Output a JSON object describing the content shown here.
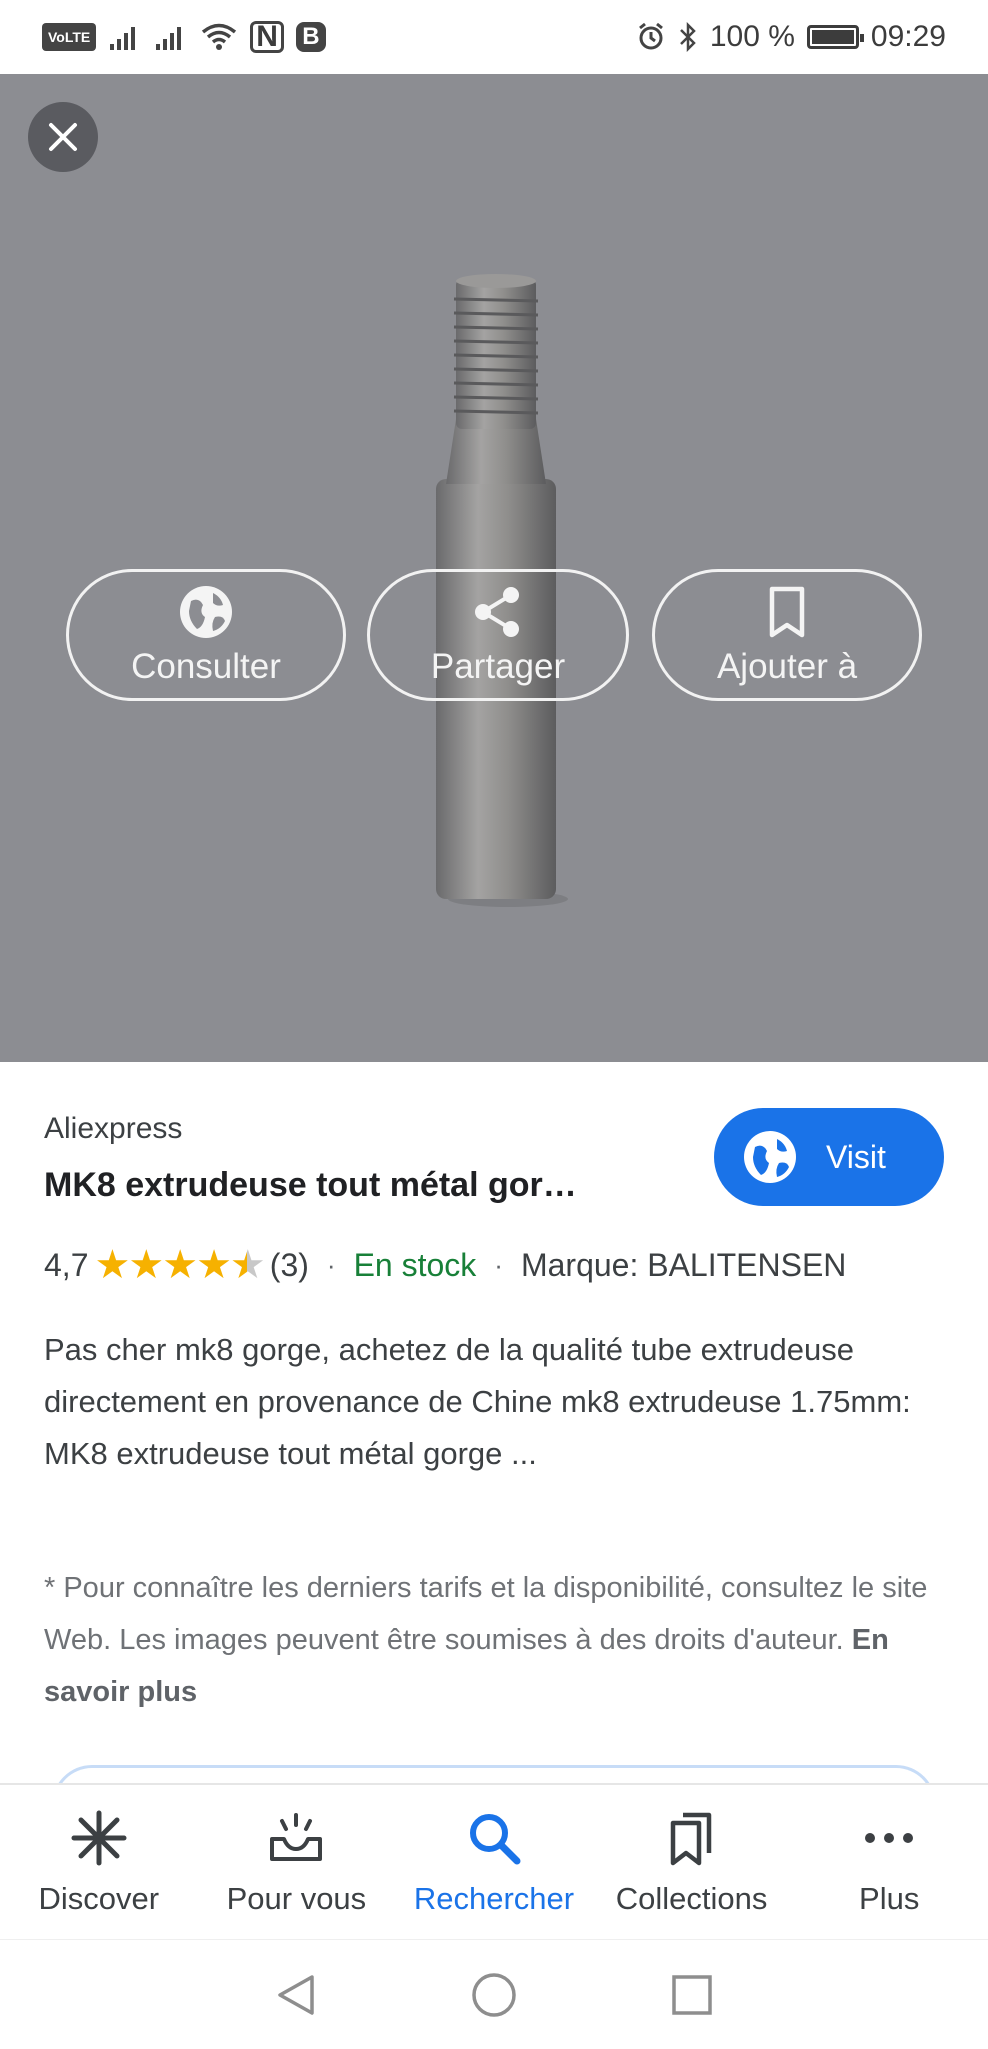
{
  "status_bar": {
    "volte": "VoLTE",
    "bluetooth_badge": "B",
    "battery": "100 %",
    "time": "09:29"
  },
  "viewer": {
    "background": "#8c8d92",
    "actions": [
      {
        "label": "Consulter",
        "icon": "globe-icon"
      },
      {
        "label": "Partager",
        "icon": "share-icon"
      },
      {
        "label": "Ajouter à",
        "icon": "bookmark-icon"
      }
    ]
  },
  "result": {
    "source": "Aliexpress",
    "title": "MK8 extrudeuse tout métal gor…",
    "visit_label": "Visit",
    "rating_value": "4,7",
    "rating_stars": 4.7,
    "review_count": "(3)",
    "separator": "·",
    "stock": "En stock",
    "brand": "Marque: BALITENSEN",
    "description": "Pas cher mk8 gorge, achetez de la qualité tube extrudeuse directement en provenance de Chine mk8 extrudeuse 1.75mm: MK8 extrudeuse tout métal gorge ...",
    "disclaimer": "* Pour connaître les derniers tarifs et la disponibilité, consultez le site Web. Les images peuvent être soumises à des droits d'auteur.",
    "learn_more": "En savoir plus"
  },
  "bottom_nav": {
    "items": [
      {
        "label": "Discover",
        "icon": "discover-icon",
        "active": false
      },
      {
        "label": "Pour vous",
        "icon": "inbox-icon",
        "active": false
      },
      {
        "label": "Rechercher",
        "icon": "search-icon",
        "active": true
      },
      {
        "label": "Collections",
        "icon": "collections-icon",
        "active": false
      },
      {
        "label": "Plus",
        "icon": "more-icon",
        "active": false
      }
    ]
  },
  "colors": {
    "accent": "#1a73e8",
    "stock_green": "#188038",
    "star": "#f6b100"
  }
}
